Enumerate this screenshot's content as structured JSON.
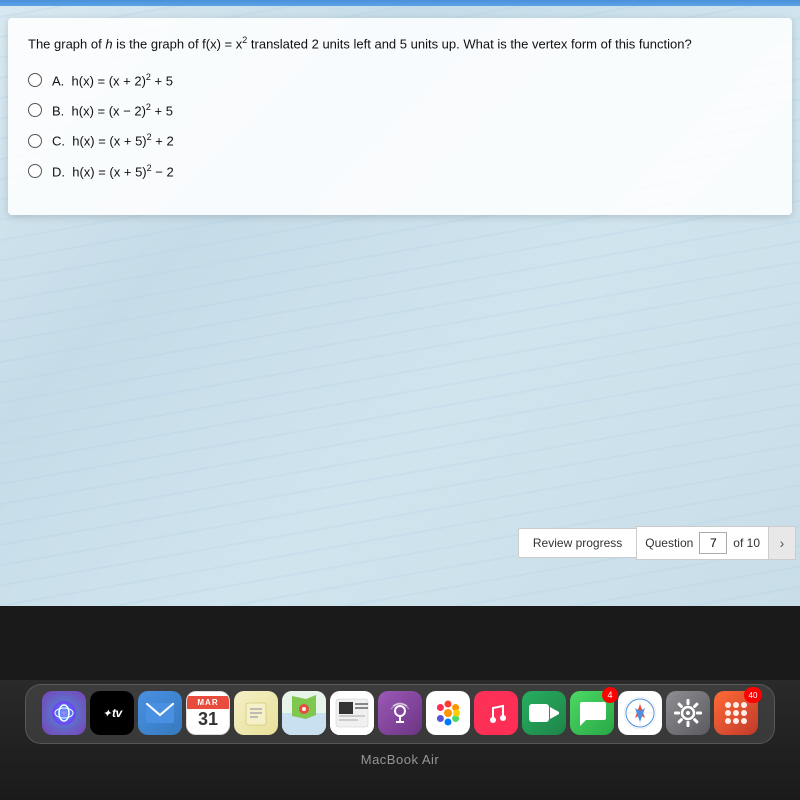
{
  "screen": {
    "top_bar_color": "#4a90d9"
  },
  "question": {
    "text": "The graph of h is the graph of f(x) = x² translated 2 units left and 5 units up. What is the vertex form of this function?",
    "options": [
      {
        "letter": "A.",
        "formula": "h(x) = (x + 2)² + 5"
      },
      {
        "letter": "B.",
        "formula": "h(x) = (x − 2)² + 5"
      },
      {
        "letter": "C.",
        "formula": "h(x) = (x + 5)² + 2"
      },
      {
        "letter": "D.",
        "formula": "h(x) = (x + 5)² − 2"
      }
    ]
  },
  "toolbar": {
    "review_progress_label": "Review progress",
    "question_label": "Question",
    "current_question": "7",
    "total_questions": "of 10"
  },
  "dock": {
    "items": [
      {
        "name": "siri",
        "label": "Siri",
        "emoji": "🎙"
      },
      {
        "name": "apple-tv",
        "label": "Apple TV",
        "text": "✦tv"
      },
      {
        "name": "mail",
        "label": "Mail",
        "emoji": "✉"
      },
      {
        "name": "calendar",
        "label": "Calendar",
        "text": "31"
      },
      {
        "name": "notes",
        "label": "Notes",
        "emoji": "📝"
      },
      {
        "name": "maps",
        "label": "Maps",
        "emoji": "🗺"
      },
      {
        "name": "news",
        "label": "News",
        "emoji": "📰"
      },
      {
        "name": "podcasts",
        "label": "Podcasts",
        "emoji": "🎙"
      },
      {
        "name": "photos",
        "label": "Photos",
        "emoji": "🌸"
      },
      {
        "name": "music",
        "label": "Music",
        "emoji": "🎵"
      },
      {
        "name": "facetime",
        "label": "FaceTime",
        "emoji": "📹"
      },
      {
        "name": "messages",
        "label": "Messages",
        "emoji": "💬"
      },
      {
        "name": "safari",
        "label": "Safari",
        "emoji": "🧭"
      },
      {
        "name": "system-prefs",
        "label": "System Preferences",
        "emoji": "⚙"
      },
      {
        "name": "launchpad",
        "label": "Launchpad",
        "emoji": "⊞"
      }
    ],
    "macbook_label": "MacBook Air"
  }
}
